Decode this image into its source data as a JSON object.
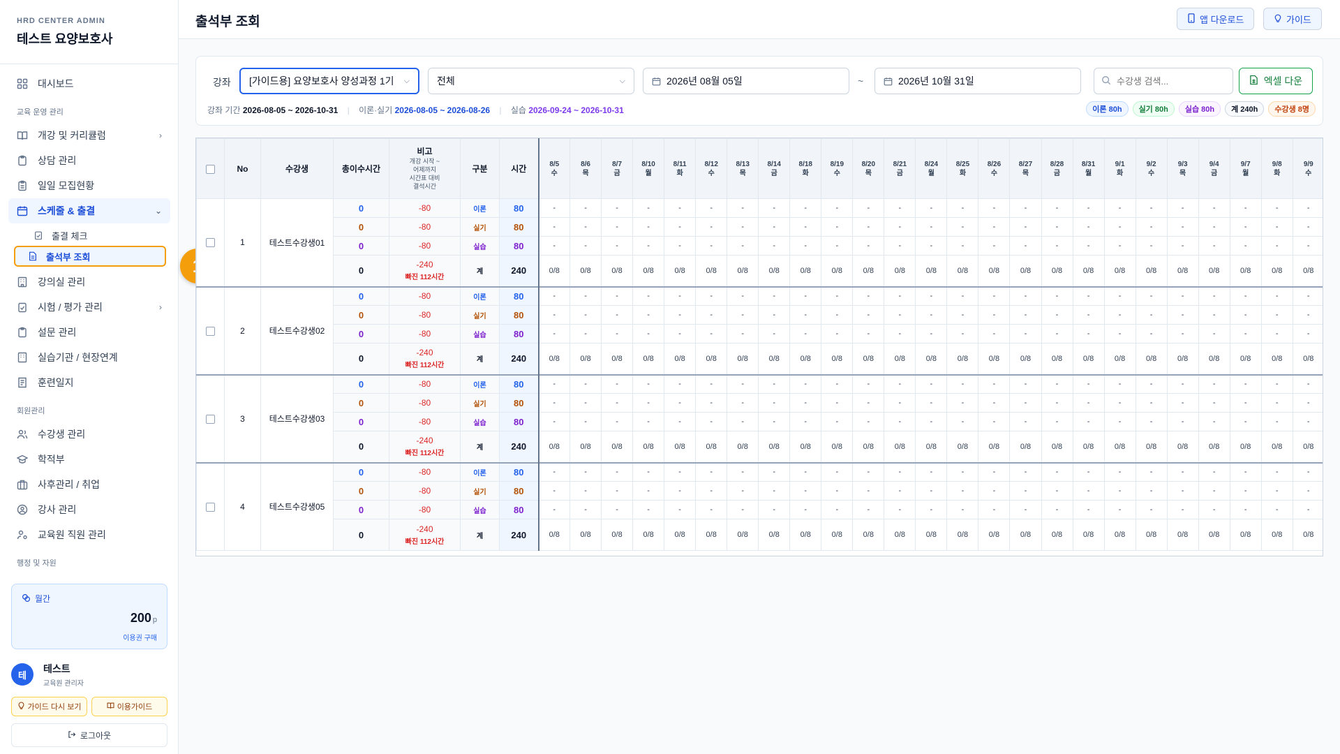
{
  "sidebar": {
    "brand_top": "HRD CENTER ADMIN",
    "brand_name": "테스트 요양보호사",
    "dashboard": "대시보드",
    "sec_edu": "교육 운영 관리",
    "item_curriculum": "개강 및 커리큘럼",
    "item_consult": "상담 관리",
    "item_daily": "일일 모집현황",
    "item_schedule": "스케줄 & 출결",
    "sub_attend_check": "출결 체크",
    "sub_attend_book": "출석부 조회",
    "item_classroom": "강의실 관리",
    "item_exam": "시험 / 평가 관리",
    "item_survey": "설문 관리",
    "item_practice": "실습기관 / 현장연계",
    "item_journal": "훈련일지",
    "sec_member": "회원관리",
    "item_students": "수강생 관리",
    "item_records": "학적부",
    "item_aftercare": "사후관리 / 취업",
    "item_instructor": "강사 관리",
    "item_staff": "교육원 직원 관리",
    "sec_admin": "행정 및 자원"
  },
  "callout": "1",
  "plan": {
    "label": "월간",
    "points": "200",
    "unit": "p",
    "buy": "이용권 구매"
  },
  "user": {
    "avatar": "테",
    "name": "테스트",
    "role": "교육원 관리자"
  },
  "buttons": {
    "guide_again": "가이드 다시 보기",
    "usage_guide": "이용가이드",
    "logout": "로그아웃"
  },
  "header": {
    "title": "출석부 조회",
    "app_download": "앱 다운로드",
    "guide": "가이드"
  },
  "filter": {
    "course_label": "강좌",
    "course_value": "[가이드용] 요양보호사 양성과정 1기",
    "type_value": "전체",
    "date_from": "2026년 08월 05일",
    "tilde": "~",
    "date_to": "2026년 10월 31일",
    "search_placeholder": "수강생 검색...",
    "excel": "엑셀 다운",
    "period_label": "강좌 기간",
    "period_value": "2026-08-05 ~ 2026-10-31",
    "theory_label": "이론·실기",
    "theory_value": "2026-08-05 ~ 2026-08-26",
    "practice_label": "실습",
    "practice_value": "2026-09-24 ~ 2026-10-31"
  },
  "badges": [
    {
      "text": "이론 80h",
      "color": "#1d4ed8",
      "bg": "#eff6ff",
      "border": "#bfdbfe"
    },
    {
      "text": "실기 80h",
      "color": "#15803d",
      "bg": "#f0fdf4",
      "border": "#bbf7d0"
    },
    {
      "text": "실습 80h",
      "color": "#7e22ce",
      "bg": "#faf5ff",
      "border": "#e9d5ff"
    },
    {
      "text": "계 240h",
      "color": "#0f172a",
      "bg": "#f8fafc",
      "border": "#cbd5e1"
    },
    {
      "text": "수강생 8명",
      "color": "#c2410c",
      "bg": "#fff7ed",
      "border": "#fed7aa"
    }
  ],
  "table": {
    "headers": {
      "no": "No",
      "student": "수강생",
      "total_hours": "총이수시간",
      "note_title": "비고",
      "note_sub": [
        "개강 시작 ~",
        "어제까지",
        "시간표 대비",
        "결석시간"
      ],
      "category": "구분",
      "hours": "시간"
    },
    "dates": [
      {
        "d": "8/5",
        "w": "수"
      },
      {
        "d": "8/6",
        "w": "목"
      },
      {
        "d": "8/7",
        "w": "금"
      },
      {
        "d": "8/10",
        "w": "월"
      },
      {
        "d": "8/11",
        "w": "화"
      },
      {
        "d": "8/12",
        "w": "수"
      },
      {
        "d": "8/13",
        "w": "목"
      },
      {
        "d": "8/14",
        "w": "금"
      },
      {
        "d": "8/18",
        "w": "화"
      },
      {
        "d": "8/19",
        "w": "수"
      },
      {
        "d": "8/20",
        "w": "목"
      },
      {
        "d": "8/21",
        "w": "금"
      },
      {
        "d": "8/24",
        "w": "월"
      },
      {
        "d": "8/25",
        "w": "화"
      },
      {
        "d": "8/26",
        "w": "수"
      },
      {
        "d": "8/27",
        "w": "목"
      },
      {
        "d": "8/28",
        "w": "금"
      },
      {
        "d": "8/31",
        "w": "월"
      },
      {
        "d": "9/1",
        "w": "화"
      },
      {
        "d": "9/2",
        "w": "수"
      },
      {
        "d": "9/3",
        "w": "목"
      },
      {
        "d": "9/4",
        "w": "금"
      },
      {
        "d": "9/7",
        "w": "월"
      },
      {
        "d": "9/8",
        "w": "화"
      },
      {
        "d": "9/9",
        "w": "수"
      }
    ],
    "empty_mark": "-",
    "sum_mark": "0/8",
    "categories": [
      {
        "label": "이론",
        "hours": "80",
        "total": "0",
        "note": "-80",
        "cls": "t-blue"
      },
      {
        "label": "실기",
        "hours": "80",
        "total": "0",
        "note": "-80",
        "cls": "t-gold"
      },
      {
        "label": "실습",
        "hours": "80",
        "total": "0",
        "note": "-80",
        "cls": "t-purple"
      }
    ],
    "sum_row": {
      "label": "계",
      "hours": "240",
      "total": "0",
      "note": "-240",
      "missing": "빠진 112시간"
    },
    "students": [
      {
        "no": "1",
        "name": "테스트수강생01"
      },
      {
        "no": "2",
        "name": "테스트수강생02"
      },
      {
        "no": "3",
        "name": "테스트수강생03"
      },
      {
        "no": "4",
        "name": "테스트수강생05"
      }
    ]
  }
}
